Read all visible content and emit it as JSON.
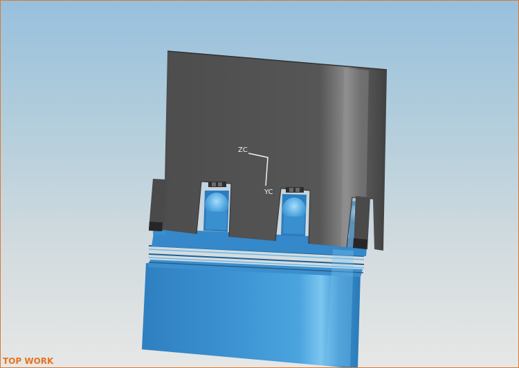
{
  "viewport": {
    "view_name": "TOP WORK",
    "border_color": "#e0772a",
    "background_top": "#97c0dd",
    "background_bottom": "#e6e7e6"
  },
  "csys": {
    "axis_z_label": "ZC",
    "axis_y_label": "YC",
    "color": "#f2f2f2"
  },
  "model": {
    "upper_part": "dark-gray-mold-plate",
    "upper_color": "#4f4f4f",
    "lower_part": "blue-core-body",
    "lower_color": "#3d93d0"
  }
}
